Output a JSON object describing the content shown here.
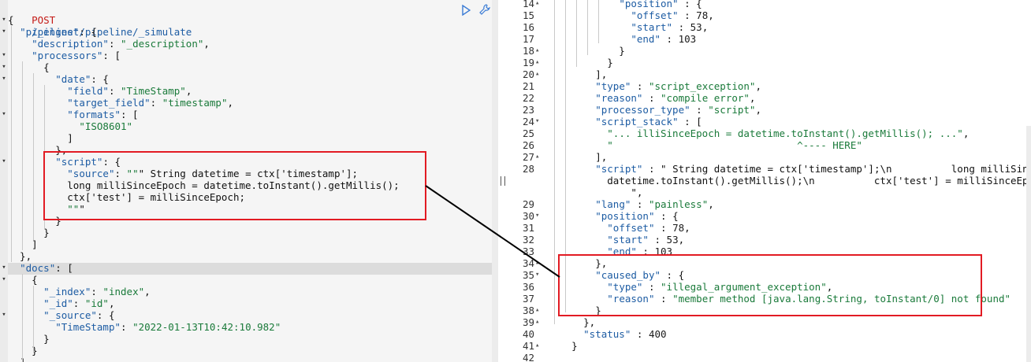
{
  "request": {
    "method": "POST",
    "path": "/_ingest/pipeline/_simulate",
    "lines": [
      "{",
      "  \"pipeline\": {",
      "    \"description\": \"_description\",",
      "    \"processors\": [",
      "      {",
      "        \"date\": {",
      "          \"field\": \"TimeStamp\",",
      "          \"target_field\": \"timestamp\",",
      "          \"formats\": [",
      "            \"ISO8601\"",
      "          ]",
      "        },",
      "        \"script\": {",
      "          \"source\": \"\"\" String datetime = ctx['timestamp'];",
      "          long milliSinceEpoch = datetime.toInstant().getMillis();",
      "          ctx['test'] = milliSinceEpoch;",
      "          \"\"\"",
      "        }",
      "      }",
      "    ]",
      "  },",
      "  \"docs\": [",
      "    {",
      "      \"_index\": \"index\",",
      "      \"_id\": \"id\",",
      "      \"_source\": {",
      "        \"TimeStamp\": \"2022-01-13T10:42:10.982\"",
      "      }",
      "    }",
      "  ]"
    ],
    "fold_markers": [
      "▾",
      "▾",
      "",
      "▾",
      "▾",
      "▾",
      "",
      "",
      "▾",
      "",
      "",
      "",
      "▾",
      "",
      "",
      "",
      "",
      "",
      "",
      "",
      "",
      "▾",
      "▾",
      "",
      "",
      "▾",
      "",
      "",
      "",
      ""
    ]
  },
  "response": {
    "lines": [
      {
        "n": "14",
        "fold": "▴",
        "text": "            \"position\" : {"
      },
      {
        "n": "15",
        "fold": "",
        "text": "              \"offset\" : 78,"
      },
      {
        "n": "16",
        "fold": "",
        "text": "              \"start\" : 53,"
      },
      {
        "n": "17",
        "fold": "",
        "text": "              \"end\" : 103"
      },
      {
        "n": "18",
        "fold": "▴",
        "text": "            }"
      },
      {
        "n": "19",
        "fold": "▴",
        "text": "          }"
      },
      {
        "n": "20",
        "fold": "▴",
        "text": "        ],"
      },
      {
        "n": "21",
        "fold": "",
        "text": "        \"type\" : \"script_exception\","
      },
      {
        "n": "22",
        "fold": "",
        "text": "        \"reason\" : \"compile error\","
      },
      {
        "n": "23",
        "fold": "",
        "text": "        \"processor_type\" : \"script\","
      },
      {
        "n": "24",
        "fold": "▾",
        "text": "        \"script_stack\" : ["
      },
      {
        "n": "25",
        "fold": "",
        "text": "          \"... illiSinceEpoch = datetime.toInstant().getMillis(); ...\","
      },
      {
        "n": "26",
        "fold": "",
        "text": "          \"                               ^---- HERE\""
      },
      {
        "n": "27",
        "fold": "▴",
        "text": "        ],"
      },
      {
        "n": "28",
        "fold": "",
        "text": "        \"script\" : \" String datetime = ctx['timestamp'];\\n          long milliSinceEpoch ="
      },
      {
        "n": "",
        "fold": "",
        "text": "          datetime.toInstant().getMillis();\\n          ctx['test'] = milliSinceEpoch;\\n"
      },
      {
        "n": "",
        "fold": "",
        "text": "              \","
      },
      {
        "n": "29",
        "fold": "",
        "text": "        \"lang\" : \"painless\","
      },
      {
        "n": "30",
        "fold": "▾",
        "text": "        \"position\" : {"
      },
      {
        "n": "31",
        "fold": "",
        "text": "          \"offset\" : 78,"
      },
      {
        "n": "32",
        "fold": "",
        "text": "          \"start\" : 53,"
      },
      {
        "n": "33",
        "fold": "",
        "text": "          \"end\" : 103"
      },
      {
        "n": "34",
        "fold": "▴",
        "text": "        },"
      },
      {
        "n": "35",
        "fold": "▾",
        "text": "        \"caused_by\" : {"
      },
      {
        "n": "36",
        "fold": "",
        "text": "          \"type\" : \"illegal_argument_exception\","
      },
      {
        "n": "37",
        "fold": "",
        "text": "          \"reason\" : \"member method [java.lang.String, toInstant/0] not found\""
      },
      {
        "n": "38",
        "fold": "▴",
        "text": "        }"
      },
      {
        "n": "39",
        "fold": "▴",
        "text": "      },"
      },
      {
        "n": "40",
        "fold": "",
        "text": "      \"status\" : 400"
      },
      {
        "n": "41",
        "fold": "▴",
        "text": "    }"
      },
      {
        "n": "42",
        "fold": "",
        "text": ""
      }
    ]
  },
  "icons": {
    "run": "play-icon",
    "settings": "wrench-icon",
    "divider": "pane-resize-handle-icon"
  },
  "colors": {
    "highlight_box": "#e21b23",
    "key": "#1d5ca3",
    "string": "#1a7a3a",
    "method": "#c41a16"
  }
}
